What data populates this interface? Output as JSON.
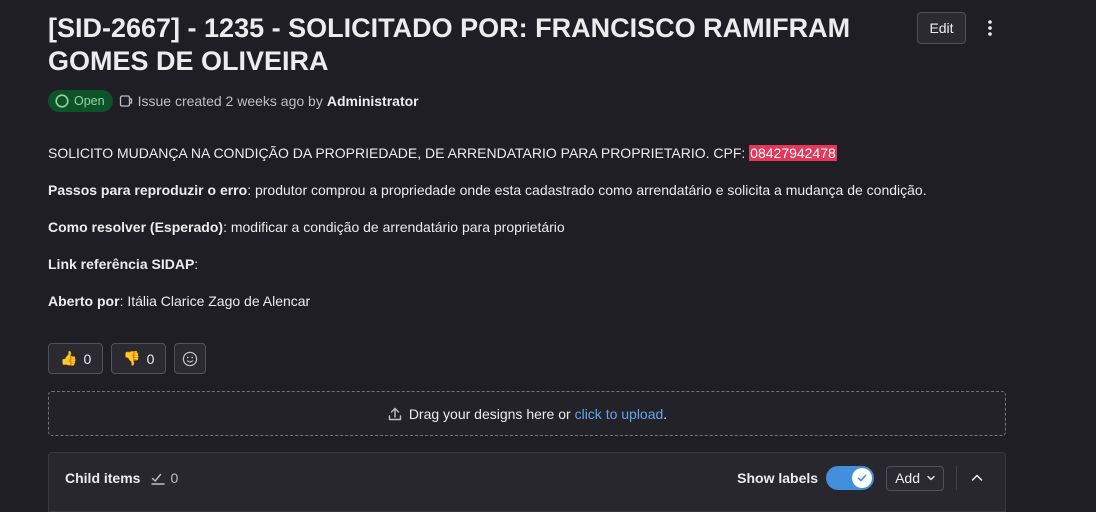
{
  "issue": {
    "title": "[SID-2667] - 1235 - SOLICITADO POR: FRANCISCO RAMIFRAM GOMES DE OLIVEIRA",
    "edit_label": "Edit",
    "status": "Open",
    "meta_prefix": "Issue created 2 weeks ago by",
    "author": "Administrator"
  },
  "description": {
    "line1_text": "SOLICITO MUDANÇA NA CONDIÇÃO DA PROPRIEDADE, DE ARRENDATARIO PARA PROPRIETARIO. CPF: ",
    "cpf": "08427942478",
    "steps_label": "Passos para reproduzir o erro",
    "steps_text": ": produtor comprou a propriedade onde esta cadastrado como arrendatário e solicita a mudança de condição.",
    "resolve_label": "Como resolver (Esperado)",
    "resolve_text": ": modificar a condição de arrendatário para proprietário",
    "link_label": "Link referência SIDAP",
    "link_text": ":",
    "opened_label": "Aberto por",
    "opened_text": ": Itália Clarice Zago de Alencar"
  },
  "reactions": {
    "thumbs_up_emoji": "👍",
    "thumbs_up_count": "0",
    "thumbs_down_emoji": "👎",
    "thumbs_down_count": "0"
  },
  "designs": {
    "prefix": "Drag your designs here or ",
    "link": "click to upload",
    "suffix": "."
  },
  "child_items": {
    "title": "Child items",
    "count": "0",
    "show_labels": "Show labels",
    "show_labels_on": true,
    "add_label": "Add"
  },
  "colors": {
    "background": "#1f1e24",
    "status_open_bg": "#0d532a",
    "status_open_fg": "#91d4a8",
    "cpf_highlight": "#e4375a",
    "link": "#63a6e9",
    "toggle_on": "#428fdc"
  },
  "icons": {
    "kebab": "vertical-ellipsis-icon",
    "status": "issue-open-icon",
    "issue_type": "issue-type-icon",
    "add_reaction": "smiley-icon",
    "upload": "upload-icon",
    "child_count": "task-done-icon",
    "toggle": "check-icon",
    "add_dropdown": "chevron-down-icon",
    "collapse": "chevron-up-icon"
  }
}
